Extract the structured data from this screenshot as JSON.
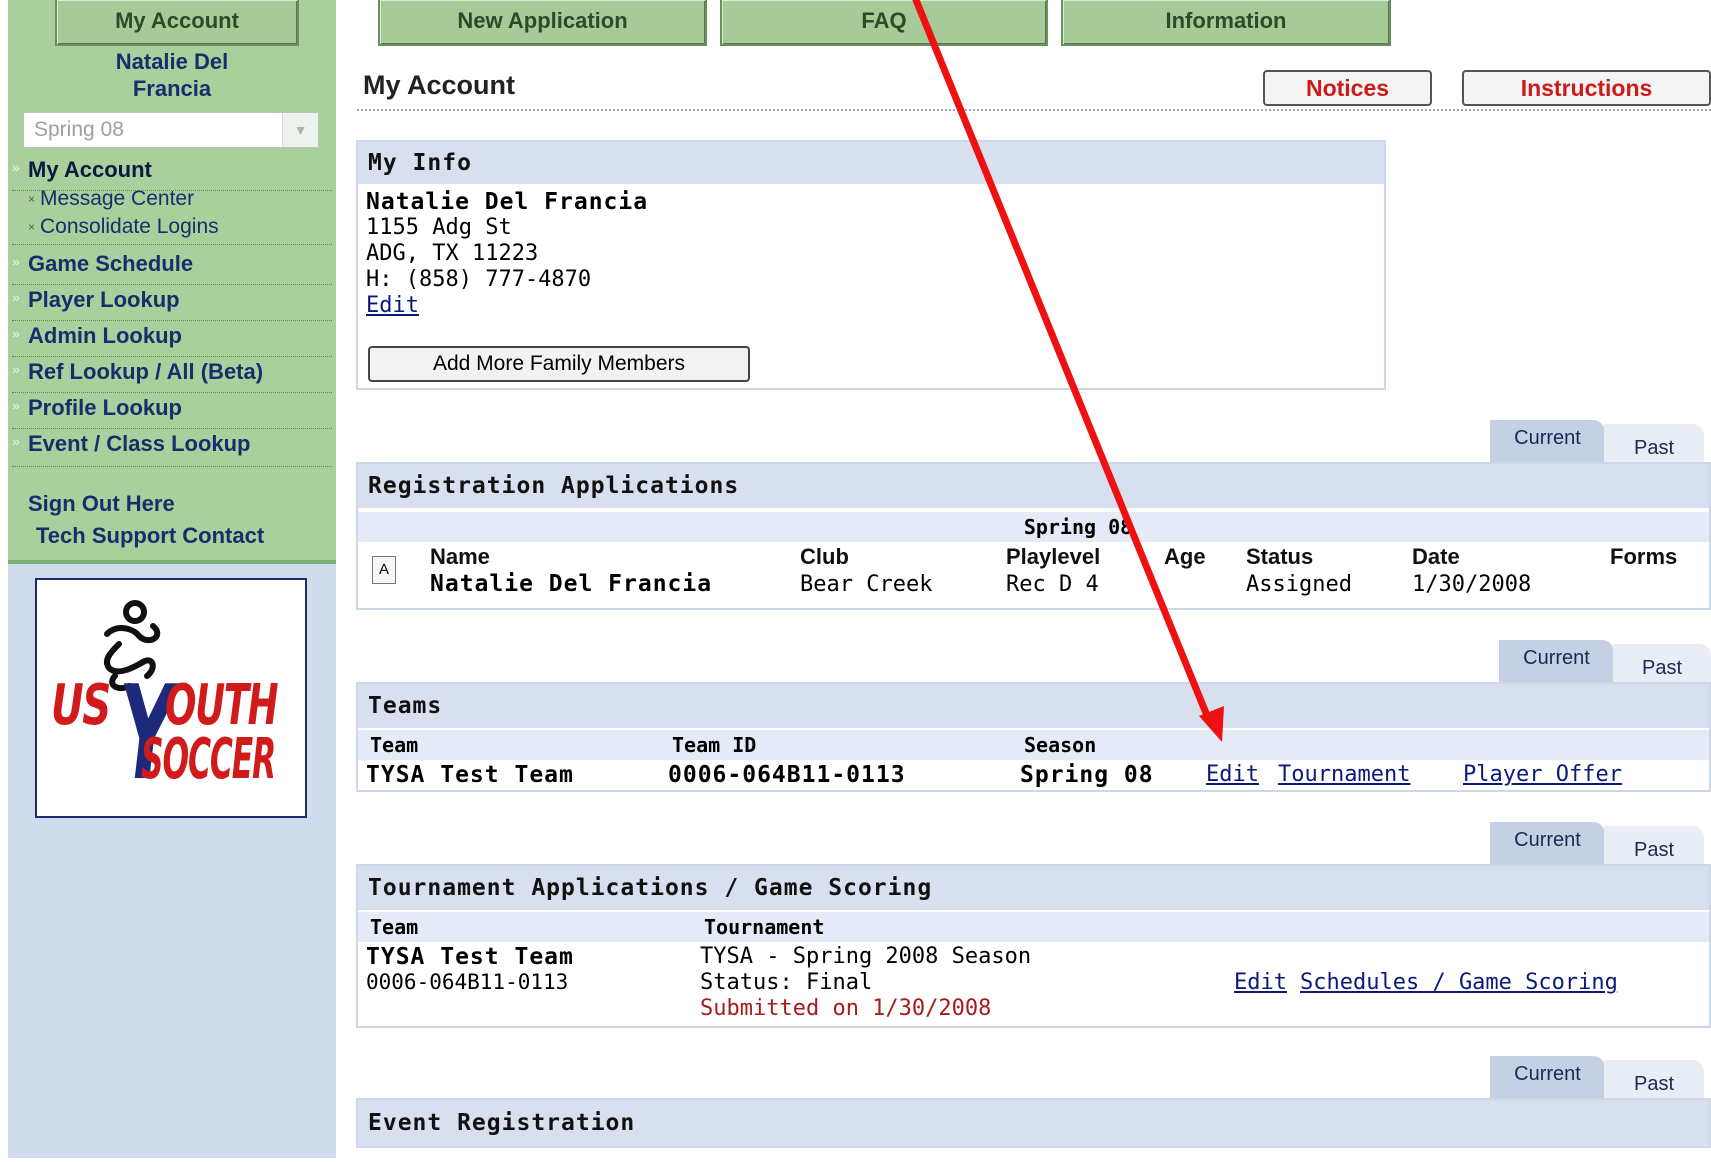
{
  "sidebar": {
    "my_account_button": "My Account",
    "user_name_line1": "Natalie Del",
    "user_name_line2": "Francia",
    "season_select": "Spring 08",
    "nav": {
      "my_account": "My Account",
      "message_center": "Message Center",
      "consolidate_logins": "Consolidate Logins",
      "game_schedule": "Game Schedule",
      "player_lookup": "Player Lookup",
      "admin_lookup": "Admin Lookup",
      "ref_lookup": "Ref Lookup / All (Beta)",
      "profile_lookup": "Profile Lookup",
      "event_class_lookup": "Event / Class Lookup"
    },
    "sign_out": "Sign Out Here",
    "tech_support": "Tech Support Contact",
    "logo": {
      "line1": "US",
      "line2": "OUTH",
      "line3": "SOCCER",
      "letter": "Y"
    }
  },
  "top_tabs": {
    "new_application": "New Application",
    "faq": "FAQ",
    "information": "Information"
  },
  "header": {
    "title": "My Account",
    "notices": "Notices",
    "instructions": "Instructions"
  },
  "my_info": {
    "title": "My Info",
    "name": "Natalie Del Francia",
    "address1": "1155 Adg St",
    "address2": "ADG, TX 11223",
    "phone": "H: (858) 777-4870",
    "edit": "Edit",
    "add_family": "Add More Family Members"
  },
  "tabs": {
    "current": "Current",
    "past": "Past"
  },
  "registration": {
    "title": "Registration Applications",
    "season": "Spring 08",
    "badge": "A",
    "columns": {
      "name": "Name",
      "club": "Club",
      "playlevel": "Playlevel",
      "age": "Age",
      "status": "Status",
      "date": "Date",
      "forms": "Forms"
    },
    "row": {
      "name": "Natalie Del Francia",
      "club": "Bear Creek",
      "playlevel": "Rec D 4",
      "age": "",
      "status": "Assigned",
      "date": "1/30/2008"
    }
  },
  "teams": {
    "title": "Teams",
    "columns": {
      "team": "Team",
      "team_id": "Team ID",
      "season": "Season"
    },
    "row": {
      "team": "TYSA Test Team",
      "team_id": "0006-064B11-0113",
      "season": "Spring 08"
    },
    "links": {
      "edit": "Edit",
      "tournament": "Tournament",
      "player_offer": "Player Offer"
    }
  },
  "tournament": {
    "title": "Tournament Applications / Game Scoring",
    "columns": {
      "team": "Team",
      "tournament": "Tournament"
    },
    "row": {
      "team": "TYSA Test Team",
      "team_id": "0006-064B11-0113",
      "tournament": "TYSA - Spring 2008 Season",
      "status": "Status: Final",
      "submitted": "Submitted on 1/30/2008"
    },
    "links": {
      "edit": "Edit",
      "schedules": "Schedules / Game Scoring"
    }
  },
  "event_registration": {
    "title": "Event Registration"
  },
  "colors": {
    "sidebar_green": "#a9cf9c",
    "sidebar_blue": "#d0dcec",
    "panel_header": "#d8e0ef",
    "nav_text": "#142f6b",
    "header_button_text": "#cc1a1a",
    "annotation_arrow": "#ee1111",
    "submitted_text": "#a41c1c"
  }
}
